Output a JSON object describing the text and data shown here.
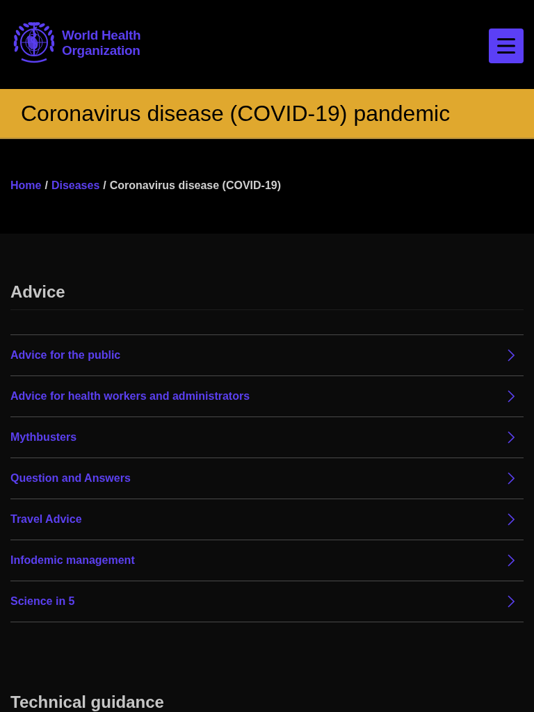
{
  "header": {
    "logo_text": "World Health Organization"
  },
  "banner": {
    "title": "Coronavirus disease (COVID-19) pandemic"
  },
  "breadcrumb": [
    {
      "label": "Home",
      "kind": "link"
    },
    {
      "label": "/",
      "kind": "separator"
    },
    {
      "label": "Diseases",
      "kind": "link"
    },
    {
      "label": "/",
      "kind": "separator"
    },
    {
      "label": "Coronavirus disease (COVID-19)",
      "kind": "current"
    }
  ],
  "sections": [
    {
      "heading": "Advice",
      "links": [
        {
          "label": "Advice for the public"
        },
        {
          "label": "Advice for health workers and administrators"
        },
        {
          "label": "Mythbusters"
        },
        {
          "label": "Question and Answers"
        },
        {
          "label": "Travel Advice"
        },
        {
          "label": "Infodemic management"
        },
        {
          "label": "Science in 5"
        }
      ]
    },
    {
      "heading": "Technical guidance"
    }
  ]
}
